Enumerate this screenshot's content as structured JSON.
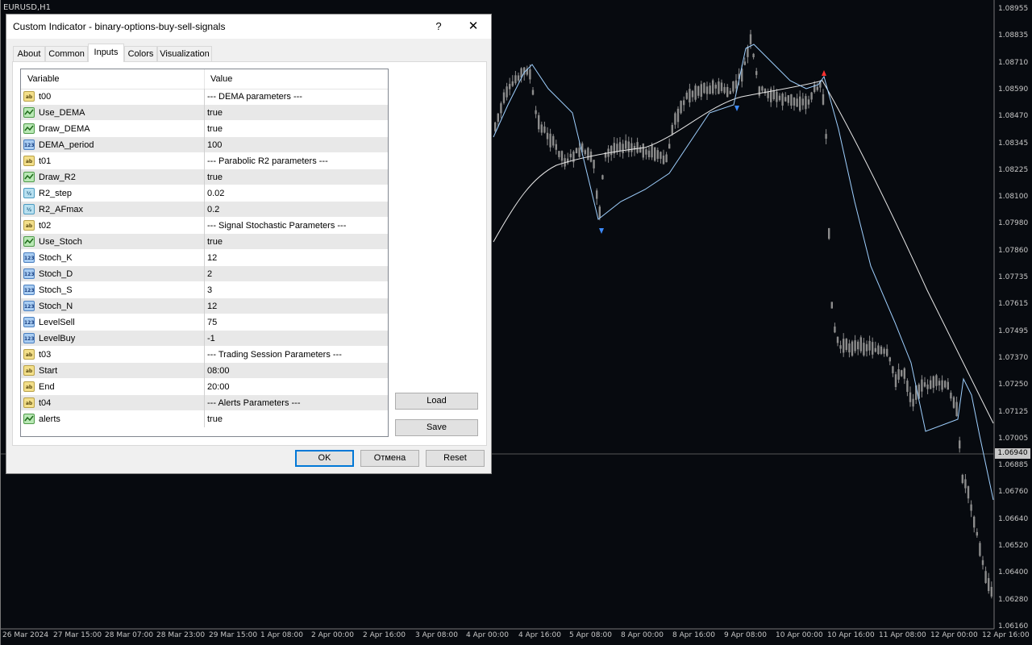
{
  "chart": {
    "title": "EURUSD,H1",
    "current_price": "1.06940",
    "price_labels": [
      "1.08955",
      "1.08835",
      "1.08710",
      "1.08590",
      "1.08470",
      "1.08345",
      "1.08225",
      "1.08100",
      "1.07980",
      "1.07860",
      "1.07735",
      "1.07615",
      "1.07495",
      "1.07370",
      "1.07250",
      "1.07125",
      "1.07005",
      "1.06885",
      "1.06760",
      "1.06640",
      "1.06520",
      "1.06400",
      "1.06280",
      "1.06160"
    ],
    "time_labels": [
      "26 Mar 2024",
      "27 Mar 15:00",
      "28 Mar 07:00",
      "28 Mar 23:00",
      "29 Mar 15:00",
      "1 Apr 08:00",
      "2 Apr 00:00",
      "2 Apr 16:00",
      "3 Apr 08:00",
      "4 Apr 00:00",
      "4 Apr 16:00",
      "5 Apr 08:00",
      "8 Apr 00:00",
      "8 Apr 16:00",
      "9 Apr 08:00",
      "10 Apr 00:00",
      "10 Apr 16:00",
      "11 Apr 08:00",
      "12 Apr 00:00",
      "12 Apr 16:00"
    ],
    "colors": {
      "background": "#070a0f",
      "candles": "#8c8c8c",
      "dema_line": "#e8e8e8",
      "r2_line": "#9fd0ff",
      "sell_arrow": "#ff3030",
      "buy_arrow": "#3d8bff"
    }
  },
  "dialog": {
    "title": "Custom Indicator - binary-options-buy-sell-signals",
    "help_label": "?",
    "close_label": "✕",
    "tabs": [
      {
        "label": "About"
      },
      {
        "label": "Common"
      },
      {
        "label": "Inputs"
      },
      {
        "label": "Colors"
      },
      {
        "label": "Visualization"
      }
    ],
    "active_tab": "Inputs",
    "grid": {
      "col_variable": "Variable",
      "col_value": "Value",
      "rows": [
        {
          "type": "string",
          "icon": "ab",
          "name": "t00",
          "value": "--- DEMA parameters ---"
        },
        {
          "type": "bool",
          "icon": "bool",
          "name": "Use_DEMA",
          "value": "true"
        },
        {
          "type": "bool",
          "icon": "bool",
          "name": "Draw_DEMA",
          "value": "true"
        },
        {
          "type": "int",
          "icon": "123",
          "name": "DEMA_period",
          "value": "100"
        },
        {
          "type": "string",
          "icon": "ab",
          "name": "t01",
          "value": "--- Parabolic R2 parameters ---"
        },
        {
          "type": "bool",
          "icon": "bool",
          "name": "Draw_R2",
          "value": "true"
        },
        {
          "type": "double",
          "icon": "½",
          "name": "R2_step",
          "value": "0.02"
        },
        {
          "type": "double",
          "icon": "½",
          "name": "R2_AFmax",
          "value": "0.2"
        },
        {
          "type": "string",
          "icon": "ab",
          "name": "t02",
          "value": "--- Signal Stochastic Parameters ---"
        },
        {
          "type": "bool",
          "icon": "bool",
          "name": "Use_Stoch",
          "value": "true"
        },
        {
          "type": "int",
          "icon": "123",
          "name": "Stoch_K",
          "value": "12"
        },
        {
          "type": "int",
          "icon": "123",
          "name": "Stoch_D",
          "value": "2"
        },
        {
          "type": "int",
          "icon": "123",
          "name": "Stoch_S",
          "value": "3"
        },
        {
          "type": "int",
          "icon": "123",
          "name": "Stoch_N",
          "value": "12"
        },
        {
          "type": "int",
          "icon": "123",
          "name": "LevelSell",
          "value": "75"
        },
        {
          "type": "int",
          "icon": "123",
          "name": "LevelBuy",
          "value": "-1"
        },
        {
          "type": "string",
          "icon": "ab",
          "name": "t03",
          "value": "--- Trading Session Parameters ---"
        },
        {
          "type": "string",
          "icon": "ab",
          "name": "Start",
          "value": "08:00"
        },
        {
          "type": "string",
          "icon": "ab",
          "name": "End",
          "value": "20:00"
        },
        {
          "type": "string",
          "icon": "ab",
          "name": "t04",
          "value": "--- Alerts Parameters ---"
        },
        {
          "type": "bool",
          "icon": "bool",
          "name": "alerts",
          "value": "true"
        }
      ]
    },
    "buttons": {
      "load": "Load",
      "save": "Save",
      "ok": "OK",
      "cancel": "Отмена",
      "reset": "Reset"
    }
  }
}
